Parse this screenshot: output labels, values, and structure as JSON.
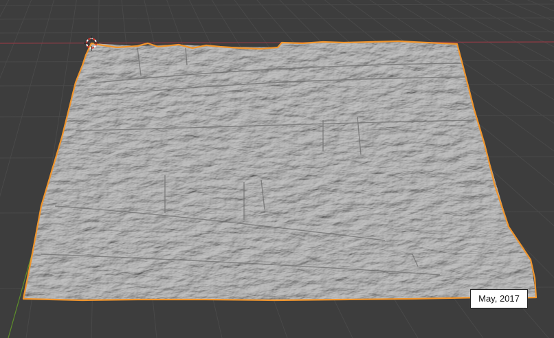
{
  "viewport": {
    "background_color": "#3d3d3d",
    "grid_color": "#494949",
    "x_axis_color": "#8f3a44",
    "y_axis_color": "#5e8f2a"
  },
  "mesh": {
    "fill_color": "#a7a7a7",
    "selection_outline_color": "#f0952d"
  },
  "origin_marker": {
    "icon": "3d-cursor-icon",
    "colors": [
      "#d93b2f",
      "#ffffff"
    ]
  },
  "date_label": {
    "text": "May, 2017"
  }
}
